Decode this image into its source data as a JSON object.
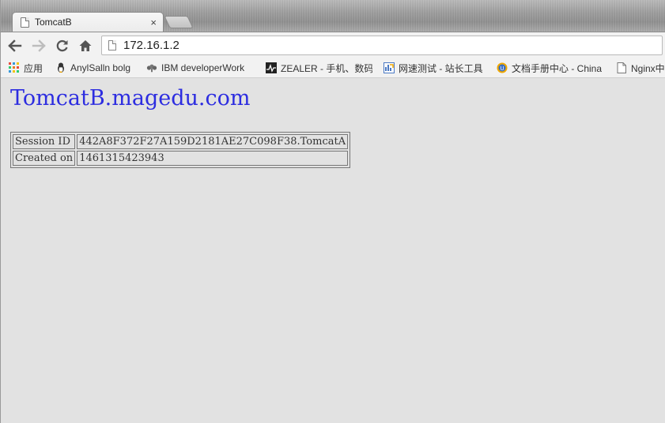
{
  "tab": {
    "title": "TomcatB",
    "close_glyph": "×"
  },
  "toolbar": {
    "back_glyph": "←",
    "forward_glyph": "→",
    "reload_glyph": "C",
    "address": "172.16.1.2"
  },
  "bookmarks": [
    {
      "label": "应用",
      "icon": "apps-grid-icon"
    },
    {
      "label": "AnylSalln bolg",
      "icon": "penguin-icon"
    },
    {
      "label": "IBM developerWork",
      "icon": "ibm-icon"
    },
    {
      "label": "ZEALER - 手机、数码",
      "icon": "zealer-icon"
    },
    {
      "label": "网速测试 - 站长工具",
      "icon": "speedtest-icon"
    },
    {
      "label": "文档手册中心 - China",
      "icon": "docs-icon"
    },
    {
      "label": "Nginx中",
      "icon": "page-icon"
    }
  ],
  "page": {
    "heading": "TomcatB.magedu.com",
    "rows": [
      {
        "label": "Session ID",
        "value": "442A8F372F27A159D2181AE27C098F38.TomcatA"
      },
      {
        "label": "Created on",
        "value": "1461315423943"
      }
    ]
  },
  "colors": {
    "heading": "#2d2de0",
    "background": "#e2e2e2"
  }
}
